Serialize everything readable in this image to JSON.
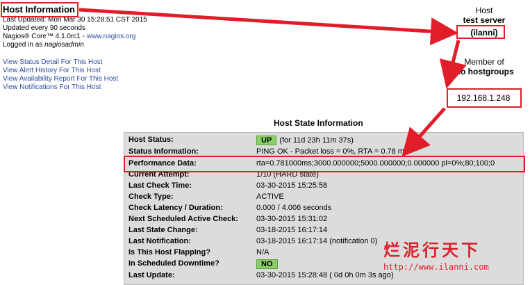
{
  "header": {
    "title": "Host Information",
    "last_updated": "Last Updated: Mon Mar 30 15:28:51 CST 2015",
    "update_interval": "Updated every 90 seconds",
    "version_prefix": "Nagios® Core™ 4.1.0rc1 - ",
    "version_link": "www.nagios.org",
    "logged_in_prefix": "Logged in as ",
    "logged_in_user": "nagiosadmin"
  },
  "nav_links": [
    "View Status Detail For This Host",
    "View Alert History For This Host",
    "View Availability Report For This Host",
    "View Notifications For This Host"
  ],
  "host": {
    "label": "Host",
    "name": "test server",
    "alias": "(ilanni)",
    "member_of": "Member of",
    "hostgroups": "No hostgroups",
    "ip": "192.168.1.248"
  },
  "state": {
    "title": "Host State Information",
    "rows": [
      {
        "label": "Host Status:",
        "badge": "UP",
        "value": "(for 11d 23h 11m 37s)"
      },
      {
        "label": "Status Information:",
        "value": "PING OK - Packet loss = 0%, RTA = 0.78 ms"
      },
      {
        "label": "Performance Data:",
        "value": "rta=0.781000ms;3000.000000;5000.000000;0.000000 pl=0%;80;100;0"
      },
      {
        "label": "Current Attempt:",
        "value": "1/10  (HARD state)"
      },
      {
        "label": "Last Check Time:",
        "value": "03-30-2015 15:25:58"
      },
      {
        "label": "Check Type:",
        "value": "ACTIVE"
      },
      {
        "label": "Check Latency / Duration:",
        "value": "0.000 / 4.006 seconds"
      },
      {
        "label": "Next Scheduled Active Check:",
        "value": "03-30-2015 15:31:02"
      },
      {
        "label": "Last State Change:",
        "value": "03-18-2015 16:17:14"
      },
      {
        "label": "Last Notification:",
        "value": "03-18-2015 16:17:14 (notification 0)"
      },
      {
        "label": "Is This Host Flapping?",
        "value": "N/A"
      },
      {
        "label": "In Scheduled Downtime?",
        "badge": "NO",
        "value": ""
      },
      {
        "label": "Last Update:",
        "value": "03-30-2015 15:28:48  ( 0d 0h 0m 3s ago)"
      }
    ]
  },
  "watermark": {
    "text": "烂泥行天下",
    "url": "http://www.ilanni.com"
  },
  "colors": {
    "annotation_red": "#e11d2a",
    "badge_green": "#88d066",
    "link_blue": "#2b4c9e",
    "table_bg": "#dcdcdc"
  }
}
